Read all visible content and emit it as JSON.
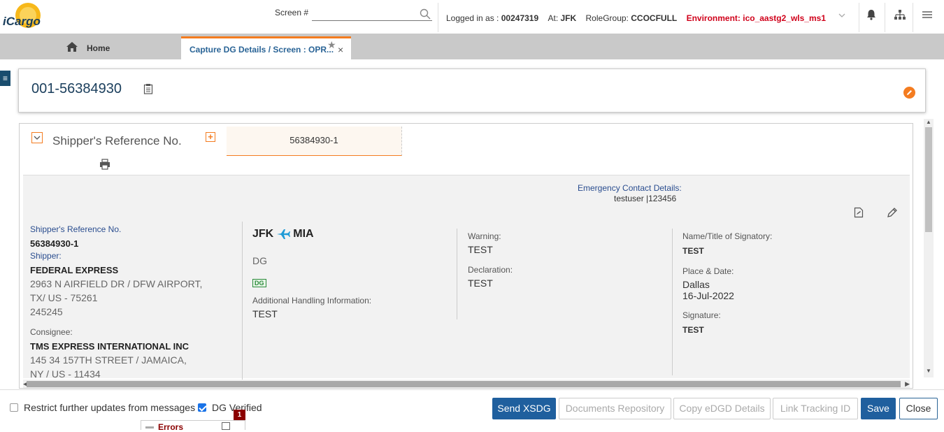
{
  "app": {
    "logo_text": "iCargo"
  },
  "header": {
    "screen_label": "Screen #",
    "screen_input_value": "",
    "logged_in_label": "Logged in as :",
    "user_id": "00247319",
    "at_label": "At:",
    "station": "JFK",
    "rolegroup_label": "RoleGroup:",
    "rolegroup": "CCOCFULL",
    "environment": "Environment: ico_aastg2_wls_ms1"
  },
  "tabs": {
    "home_label": "Home",
    "active_label": "Capture DG Details / Screen : OPR..."
  },
  "awb": {
    "number": "001-56384930"
  },
  "shipper_ref": {
    "title": "Shipper's Reference No.",
    "tab_value": "56384930-1"
  },
  "emergency": {
    "label": "Emergency Contact Details:",
    "value": "testuser |123456"
  },
  "shipper": {
    "ref_label": "Shipper's Reference No.",
    "ref_value": "56384930-1",
    "shipper_label": "Shipper:",
    "shipper_name": "FEDERAL EXPRESS",
    "address_line1": "2963 N AIRFIELD DR / DFW AIRPORT,",
    "address_line2": "TX/ US - 75261",
    "address_line3": "245245",
    "consignee_label": "Consignee:",
    "consignee_name": "TMS EXPRESS INTERNATIONAL INC",
    "consignee_line1": "145 34 157TH STREET / JAMAICA,",
    "consignee_line2": "NY / US - 11434"
  },
  "route": {
    "origin": "JFK",
    "destination": "MIA",
    "dg_text": "DG",
    "dg_badge": "DG",
    "ahi_label": "Additional Handling Information:",
    "ahi_value": "TEST"
  },
  "warning": {
    "warning_label": "Warning:",
    "warning_value": "TEST",
    "declaration_label": "Declaration:",
    "declaration_value": "TEST"
  },
  "signatory": {
    "name_label": "Name/Title of Signatory:",
    "name_value": "TEST",
    "place_label": "Place & Date:",
    "place_value": "Dallas",
    "date_value": "16-Jul-2022",
    "signature_label": "Signature:",
    "signature_value": "TEST"
  },
  "footer": {
    "restrict_label": "Restrict further updates from messages",
    "restrict_checked": false,
    "dg_verified_label": "DG Verified",
    "dg_verified_checked": true,
    "send_xsdg": "Send XSDG",
    "documents_repository": "Documents Repository",
    "copy_edgd": "Copy eDGD Details",
    "link_tracking": "Link Tracking ID",
    "save": "Save",
    "close": "Close"
  },
  "errors": {
    "label": "Errors",
    "count": "1"
  },
  "colors": {
    "accent": "#f47c20",
    "primary": "#1f5f9e",
    "env_red": "#d0021b",
    "label_blue": "#2a4d8f"
  }
}
